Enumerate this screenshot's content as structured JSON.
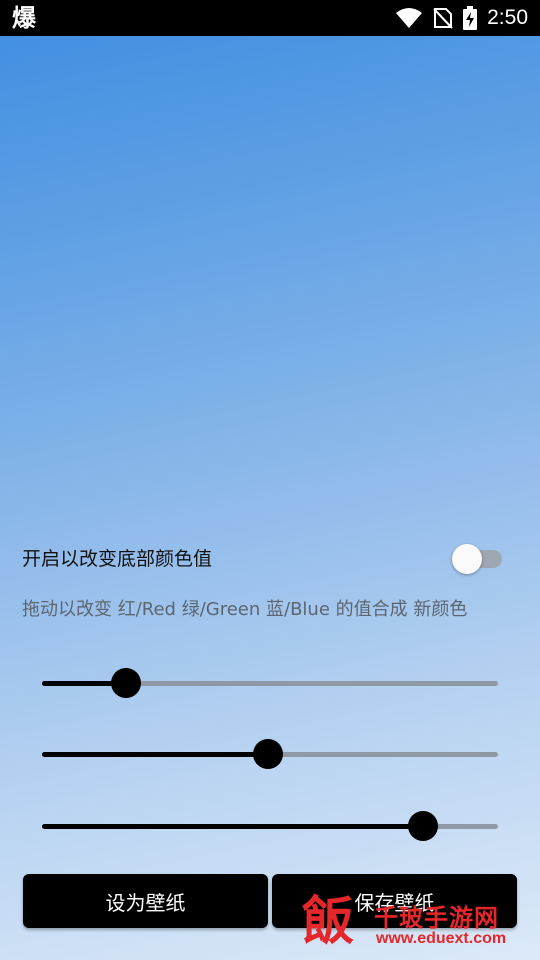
{
  "status_bar": {
    "app_icon_glyph": "爆",
    "time": "2:50",
    "icons": [
      "wifi-icon",
      "no-sim-icon",
      "battery-charging-icon"
    ]
  },
  "controls": {
    "toggle_label": "开启以改变底部颜色值",
    "toggle_on": false,
    "hint": "拖动以改变 红/Red 绿/Green 蓝/Blue 的值合成 新颜色",
    "sliders": [
      {
        "name": "red",
        "value_fraction": 0.185
      },
      {
        "name": "green",
        "value_fraction": 0.495
      },
      {
        "name": "blue",
        "value_fraction": 0.835
      }
    ]
  },
  "buttons": {
    "set_wallpaper": "设为壁纸",
    "save_wallpaper": "保存壁纸"
  },
  "watermark": {
    "logo_glyph": "飯",
    "title": "千玻手游网",
    "url": "www.eduext.com"
  },
  "colors": {
    "accent": "#000000",
    "gradient_top": "#3f8ce0",
    "gradient_bottom": "#dce9f8",
    "watermark": "#e5262b"
  }
}
